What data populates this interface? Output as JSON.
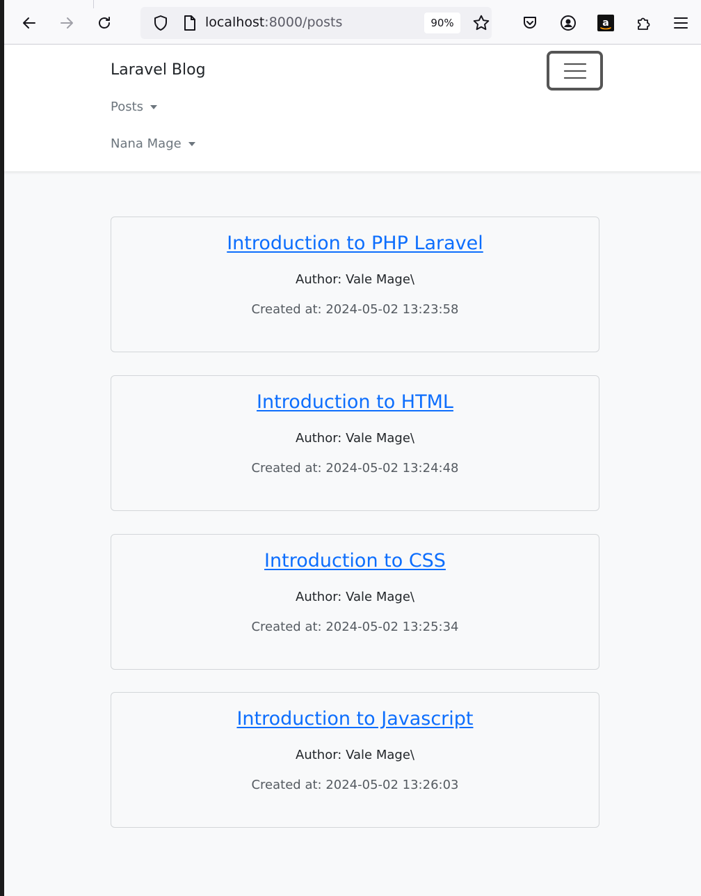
{
  "browser": {
    "url_host": "localhost",
    "url_path": ":8000/posts",
    "zoom": "90%"
  },
  "navbar": {
    "brand": "Laravel Blog",
    "items": [
      {
        "label": "Posts"
      },
      {
        "label": "Nana Mage"
      }
    ]
  },
  "posts": [
    {
      "title": "Introduction to PHP Laravel",
      "author": "Author: Vale Mage\\",
      "created": "Created at: 2024-05-02 13:23:58"
    },
    {
      "title": "Introduction to HTML",
      "author": "Author: Vale Mage\\",
      "created": "Created at: 2024-05-02 13:24:48"
    },
    {
      "title": "Introduction to CSS",
      "author": "Author: Vale Mage\\",
      "created": "Created at: 2024-05-02 13:25:34"
    },
    {
      "title": "Introduction to Javascript",
      "author": "Author: Vale Mage\\",
      "created": "Created at: 2024-05-02 13:26:03"
    }
  ],
  "colors": {
    "link": "#0d6efd",
    "page_bg": "#f8f9fa"
  }
}
